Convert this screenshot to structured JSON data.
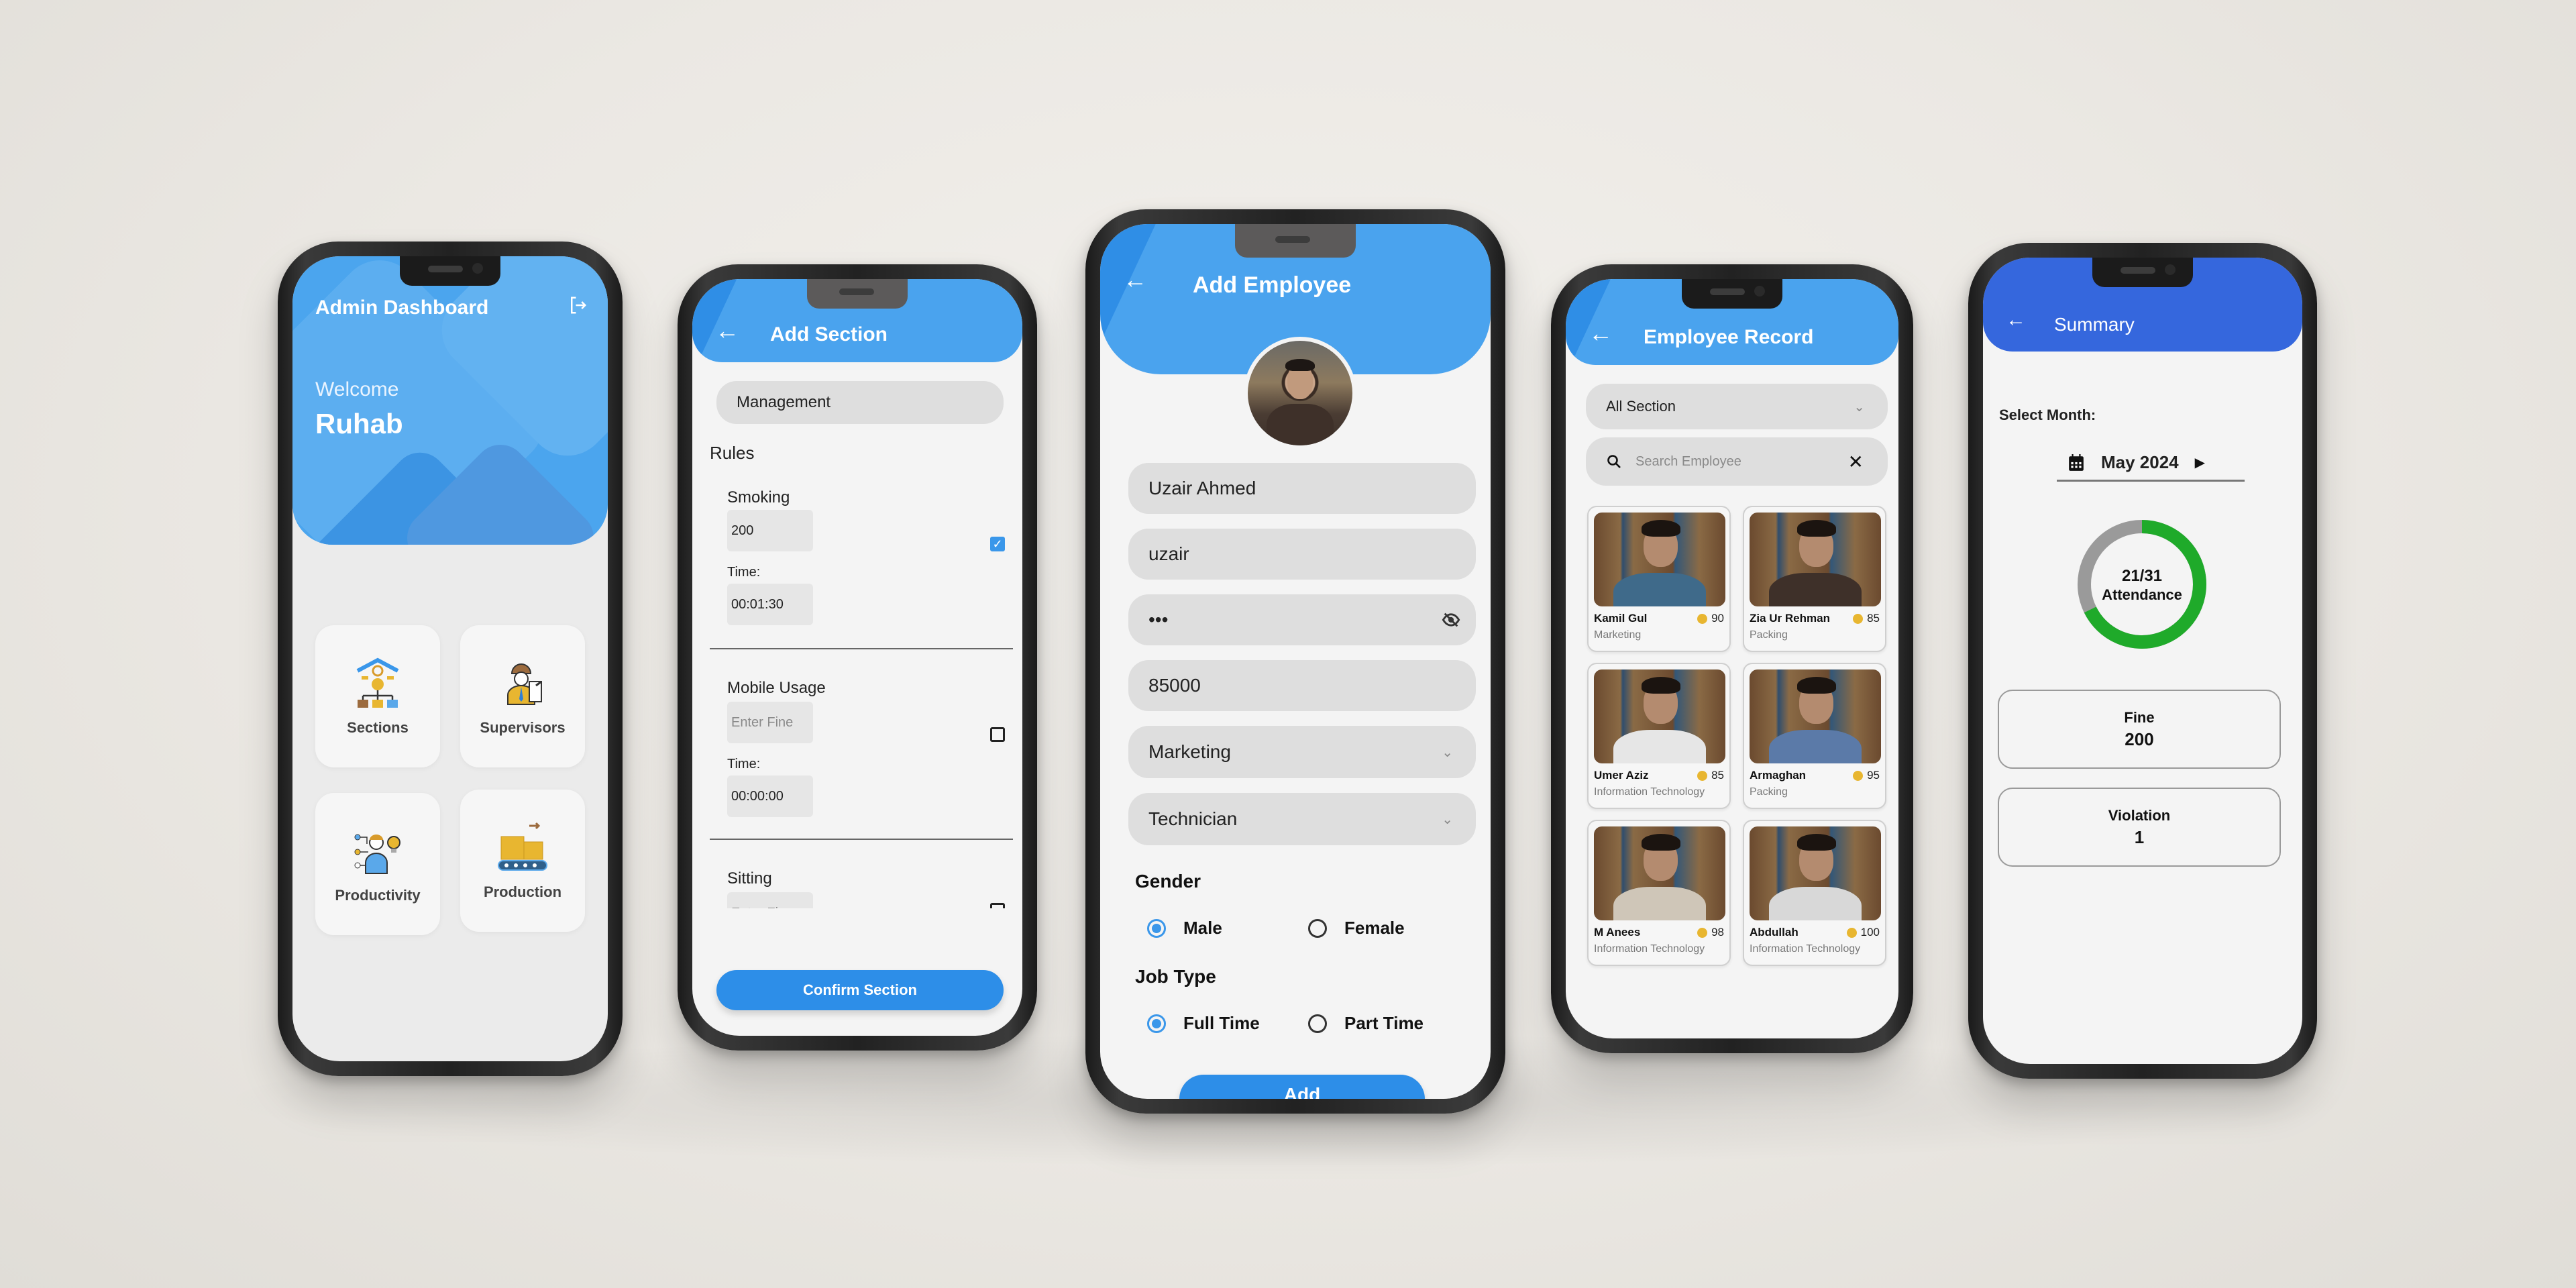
{
  "colors": {
    "primary_blue": "#4aa3ee",
    "summary_blue": "#3567dd",
    "button_blue": "#2d8ee8",
    "attendance_green": "#1faa2a",
    "attendance_grey": "#9a9a9a",
    "coin_yellow": "#e8b630"
  },
  "dashboard": {
    "title": "Admin Dashboard",
    "logout_icon": "logout-icon",
    "welcome": "Welcome",
    "user_name": "Ruhab",
    "tiles": [
      {
        "label": "Sections",
        "icon": "sections-org-icon"
      },
      {
        "label": "Supervisors",
        "icon": "supervisor-icon"
      },
      {
        "label": "Productivity",
        "icon": "productivity-icon"
      },
      {
        "label": "Production",
        "icon": "conveyor-icon"
      }
    ]
  },
  "add_section": {
    "title": "Add Section",
    "section_name": "Management",
    "rules_heading": "Rules",
    "rules": [
      {
        "name": "Smoking",
        "fine_value": "200",
        "fine_placeholder": "Enter Fine",
        "time_label": "Time:",
        "time_value": "00:01:30",
        "checked": true
      },
      {
        "name": "Mobile Usage",
        "fine_value": "",
        "fine_placeholder": "Enter Fine",
        "time_label": "Time:",
        "time_value": "00:00:00",
        "checked": false
      },
      {
        "name": "Sitting",
        "fine_value": "",
        "fine_placeholder": "Enter Fine",
        "checked": false
      }
    ],
    "confirm_label": "Confirm Section"
  },
  "add_employee": {
    "title": "Add Employee",
    "full_name": "Uzair Ahmed",
    "username": "uzair",
    "password_masked": "•••",
    "salary": "85000",
    "section": "Marketing",
    "role": "Technician",
    "gender_label": "Gender",
    "gender_options": [
      "Male",
      "Female"
    ],
    "gender_selected": "Male",
    "job_type_label": "Job Type",
    "job_type_options": [
      "Full Time",
      "Part Time"
    ],
    "job_type_selected": "Full Time",
    "add_label": "Add"
  },
  "employee_record": {
    "title": "Employee Record",
    "section_filter": "All Section",
    "search_placeholder": "Search Employee",
    "employees": [
      {
        "name": "Kamil Gul",
        "score": "90",
        "department": "Marketing"
      },
      {
        "name": "Zia Ur Rehman",
        "score": "85",
        "department": "Packing"
      },
      {
        "name": "Umer Aziz",
        "score": "85",
        "department": "Information Technology"
      },
      {
        "name": "Armaghan",
        "score": "95",
        "department": "Packing"
      },
      {
        "name": "M Anees",
        "score": "98",
        "department": "Information Technology"
      },
      {
        "name": "Abdullah",
        "score": "100",
        "department": "Information Technology"
      }
    ]
  },
  "summary": {
    "title": "Summary",
    "select_month_label": "Select Month:",
    "month": "May 2024",
    "attendance_text": "21/31",
    "attendance_label": "Attendance",
    "attendance_present": 21,
    "attendance_total": 31,
    "fine_label": "Fine",
    "fine_value": "200",
    "violation_label": "Violation",
    "violation_value": "1"
  }
}
